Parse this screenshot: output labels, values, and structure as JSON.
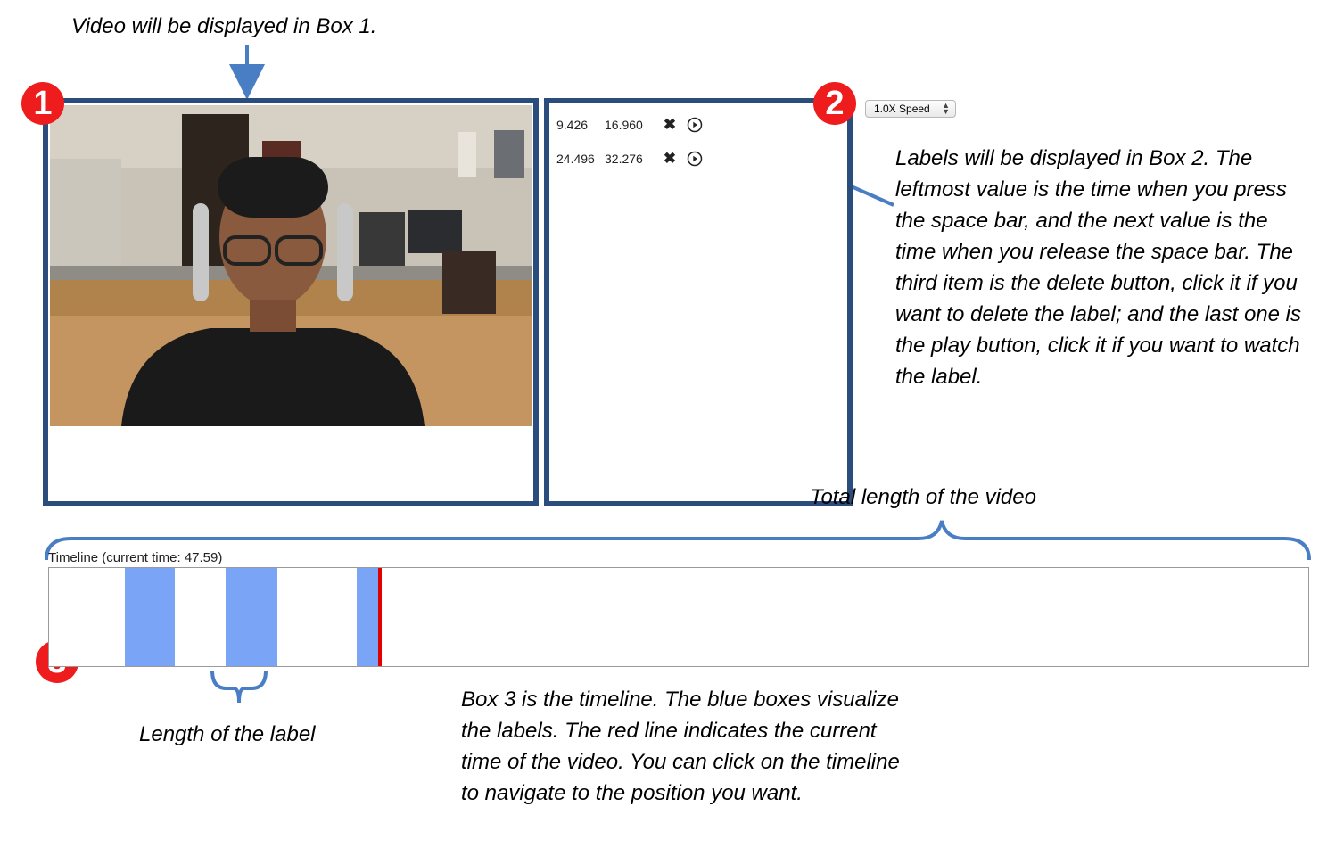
{
  "annotations": {
    "box1_note": "Video will be displayed in Box 1.",
    "box2_note": "Labels will be displayed in Box 2. The leftmost value is the time when you press the space bar, and the next value is the time when you release the space bar. The third item is the delete button, click it if you want to delete the label; and the last one is the play button, click it if you want to watch the label.",
    "total_length": "Total length of the video",
    "label_length": "Length of the label",
    "box3_note": "Box 3 is the timeline. The blue boxes visualize the labels. The red line indicates the current time of the video. You can click on the timeline to navigate to the position you want."
  },
  "badges": {
    "one": "1",
    "two": "2",
    "three": "3"
  },
  "speed_select": {
    "value": "1.0X Speed",
    "options": [
      "1.0X Speed"
    ]
  },
  "labels": [
    {
      "start": "9.426",
      "end": "16.960",
      "delete_icon": "close-icon",
      "play_icon": "play-circle-icon"
    },
    {
      "start": "24.496",
      "end": "32.276",
      "delete_icon": "close-icon",
      "play_icon": "play-circle-icon"
    }
  ],
  "timeline": {
    "title": "Timeline (current time: 47.59)",
    "current_time": 47.59,
    "segments": [
      {
        "start": 9.426,
        "end": 16.96
      },
      {
        "start": 24.496,
        "end": 32.276
      },
      {
        "start": 44.1,
        "end": 47.59
      }
    ],
    "segment_color": "#7aa4f6",
    "cursor_color": "#e00000"
  },
  "colors": {
    "box_border": "#2b4d7e",
    "badge": "#ee1c1c",
    "arrow": "#4a7ec4"
  }
}
